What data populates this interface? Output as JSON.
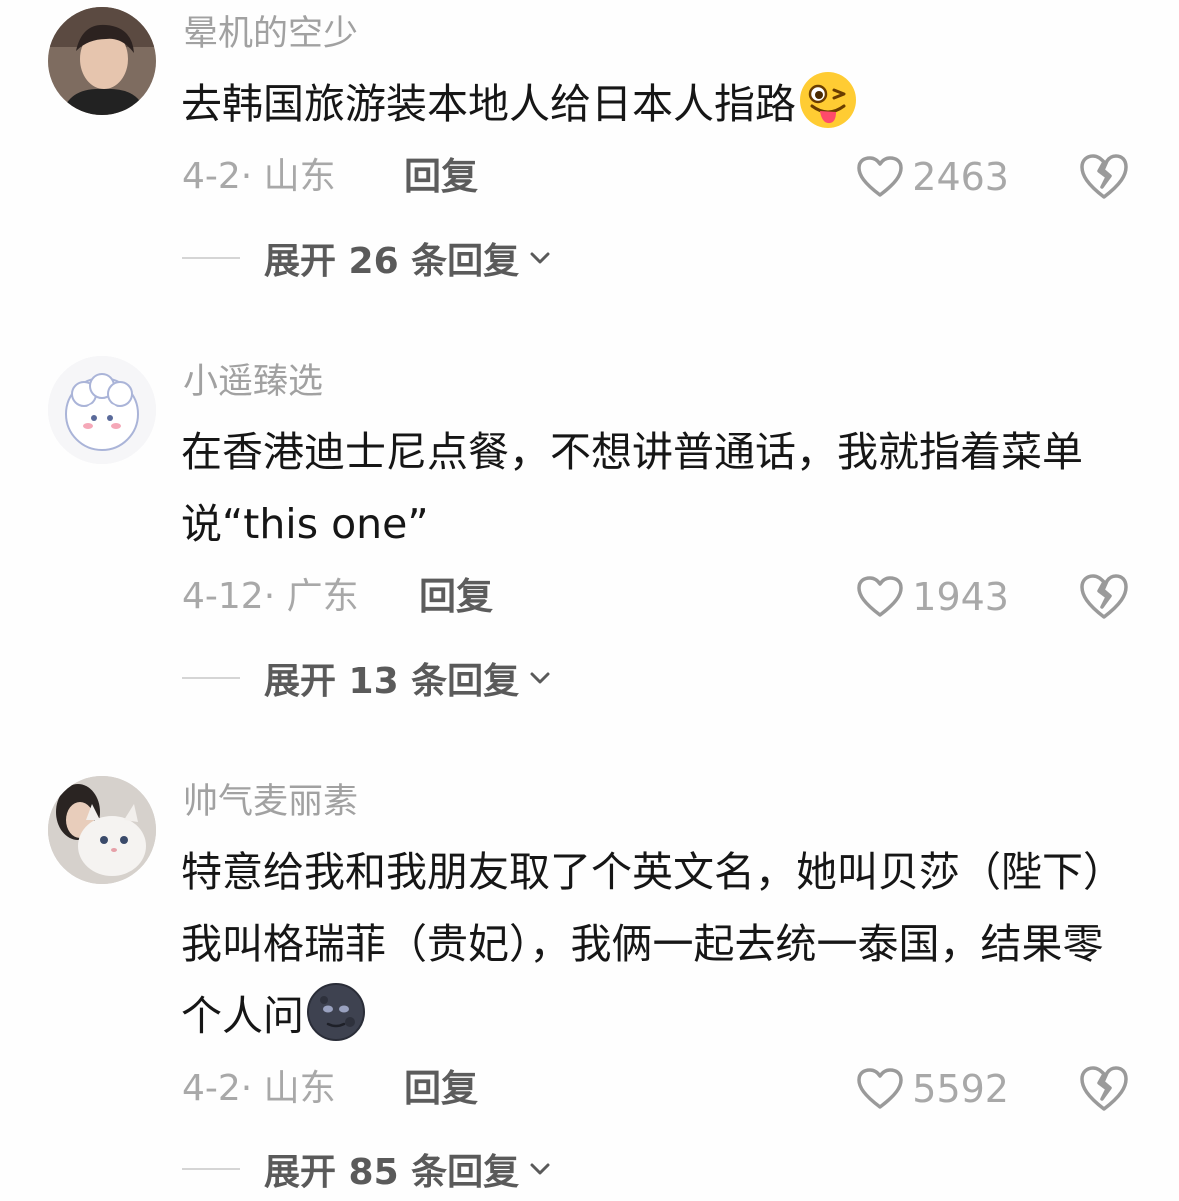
{
  "comments": [
    {
      "username": "晕机的空少",
      "text": "去韩国旅游装本地人给日本人指路",
      "emoji": "winking-tongue-face",
      "date_location": "4-2· 山东",
      "reply_label": "回复",
      "likes": "2463",
      "expand_label": "展开 26 条回复"
    },
    {
      "username": "小遥臻选",
      "text": "在香港迪士尼点餐，不想讲普通话，我就指着菜单说“this one”",
      "date_location": "4-12· 广东",
      "reply_label": "回复",
      "likes": "1943",
      "expand_label": "展开 13 条回复"
    },
    {
      "username": "帅气麦丽素",
      "text": "特意给我和我朋友取了个英文名，她叫贝莎（陛下）我叫格瑞菲（贵妃），我俩一起去统一泰国，结果零个人问",
      "emoji": "new-moon-face",
      "date_location": "4-2· 山东",
      "reply_label": "回复",
      "likes": "5592",
      "expand_label": "展开 85 条回复"
    }
  ],
  "colors": {
    "background": "#fefefe",
    "username": "#a1a1a1",
    "content": "#161616",
    "meta": "#a8a8a8",
    "reply": "#5c5c5c"
  },
  "icons": [
    "heart-outline-icon",
    "broken-heart-icon",
    "chevron-down-icon"
  ]
}
